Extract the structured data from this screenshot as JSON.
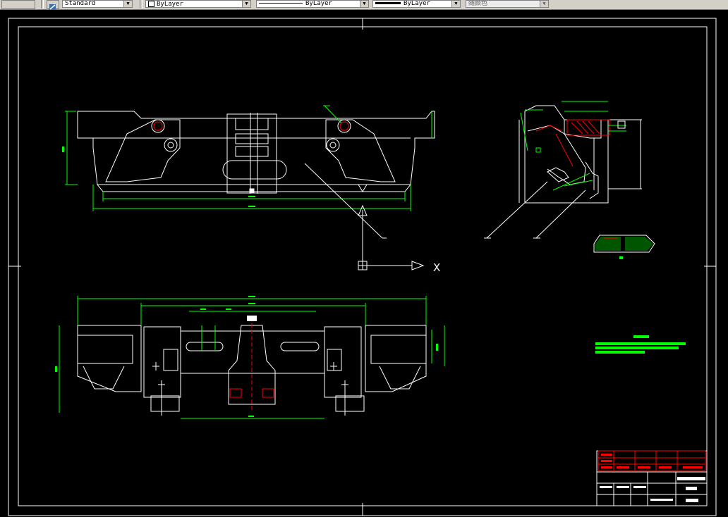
{
  "toolbar": {
    "textstyle": {
      "value": "Standard",
      "icon": "text-style-icon"
    },
    "layer_color": {
      "value": "ByLayer"
    },
    "linetype": {
      "value": "ByLayer"
    },
    "lineweight": {
      "value": "ByLayer"
    },
    "plotstyle": {
      "value": "随颜色"
    }
  },
  "drawing": {
    "ucs_x_label": "X",
    "colors": {
      "white": "#ffffff",
      "green": "#00ff00",
      "red": "#ff0000",
      "cyan": "#00ffff"
    }
  }
}
